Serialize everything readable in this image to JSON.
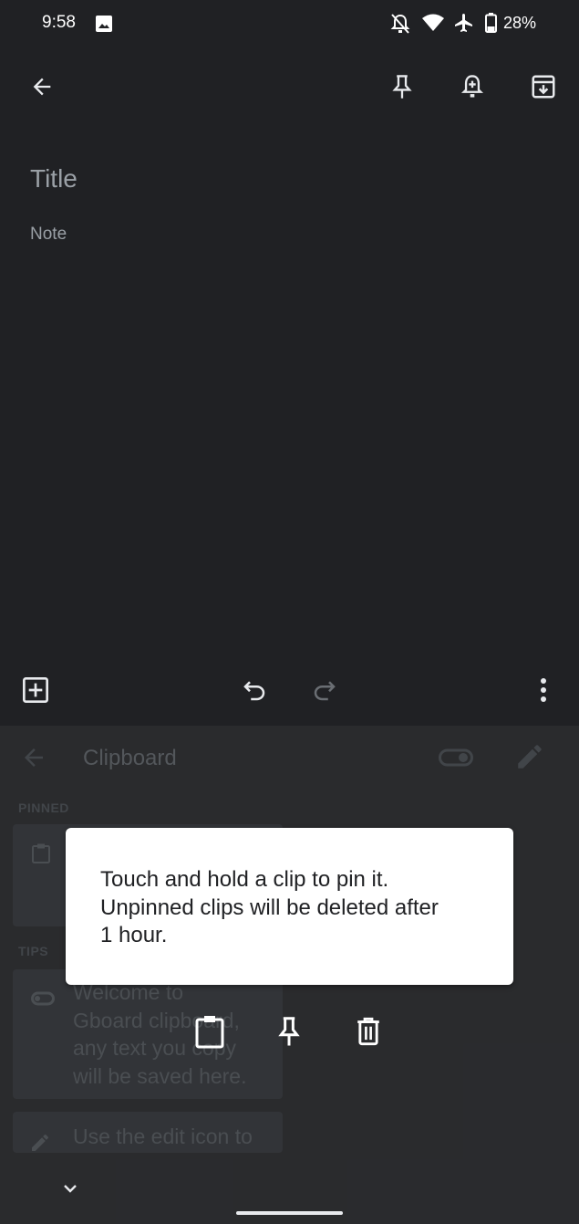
{
  "status_bar": {
    "time": "9:58",
    "battery": "28%",
    "icons": [
      "image-icon",
      "bell-off-icon",
      "wifi-icon",
      "airplane-icon",
      "battery-icon"
    ]
  },
  "toolbar": {
    "icons": [
      "back-arrow-icon",
      "pin-icon",
      "add-reminder-icon",
      "archive-icon"
    ]
  },
  "note": {
    "title_placeholder": "Title",
    "body_placeholder": "Note"
  },
  "bottom_toolbar": {
    "icons": [
      "add-box-icon",
      "undo-icon",
      "redo-icon",
      "more-vert-icon"
    ]
  },
  "clipboard": {
    "title": "Clipboard",
    "pinned_label": "PINNED",
    "tips_label": "TIPS",
    "tip_card_1": {
      "lines": [
        "Welcome to",
        "Gboard clipboard,",
        "any text you copy",
        "will be saved here."
      ]
    },
    "tip_card_2": {
      "lines": [
        "Use the edit icon to"
      ]
    }
  },
  "tooltip": {
    "lines": [
      "Touch and hold a clip to pin it.",
      "Unpinned clips will be deleted after",
      "1 hour."
    ]
  },
  "action_bar": {
    "icons": [
      "clipboard-icon",
      "pin-icon",
      "delete-icon"
    ]
  },
  "colors": {
    "background": "#202124",
    "keyboard": "#303134",
    "tooltip": "#ffffff"
  }
}
